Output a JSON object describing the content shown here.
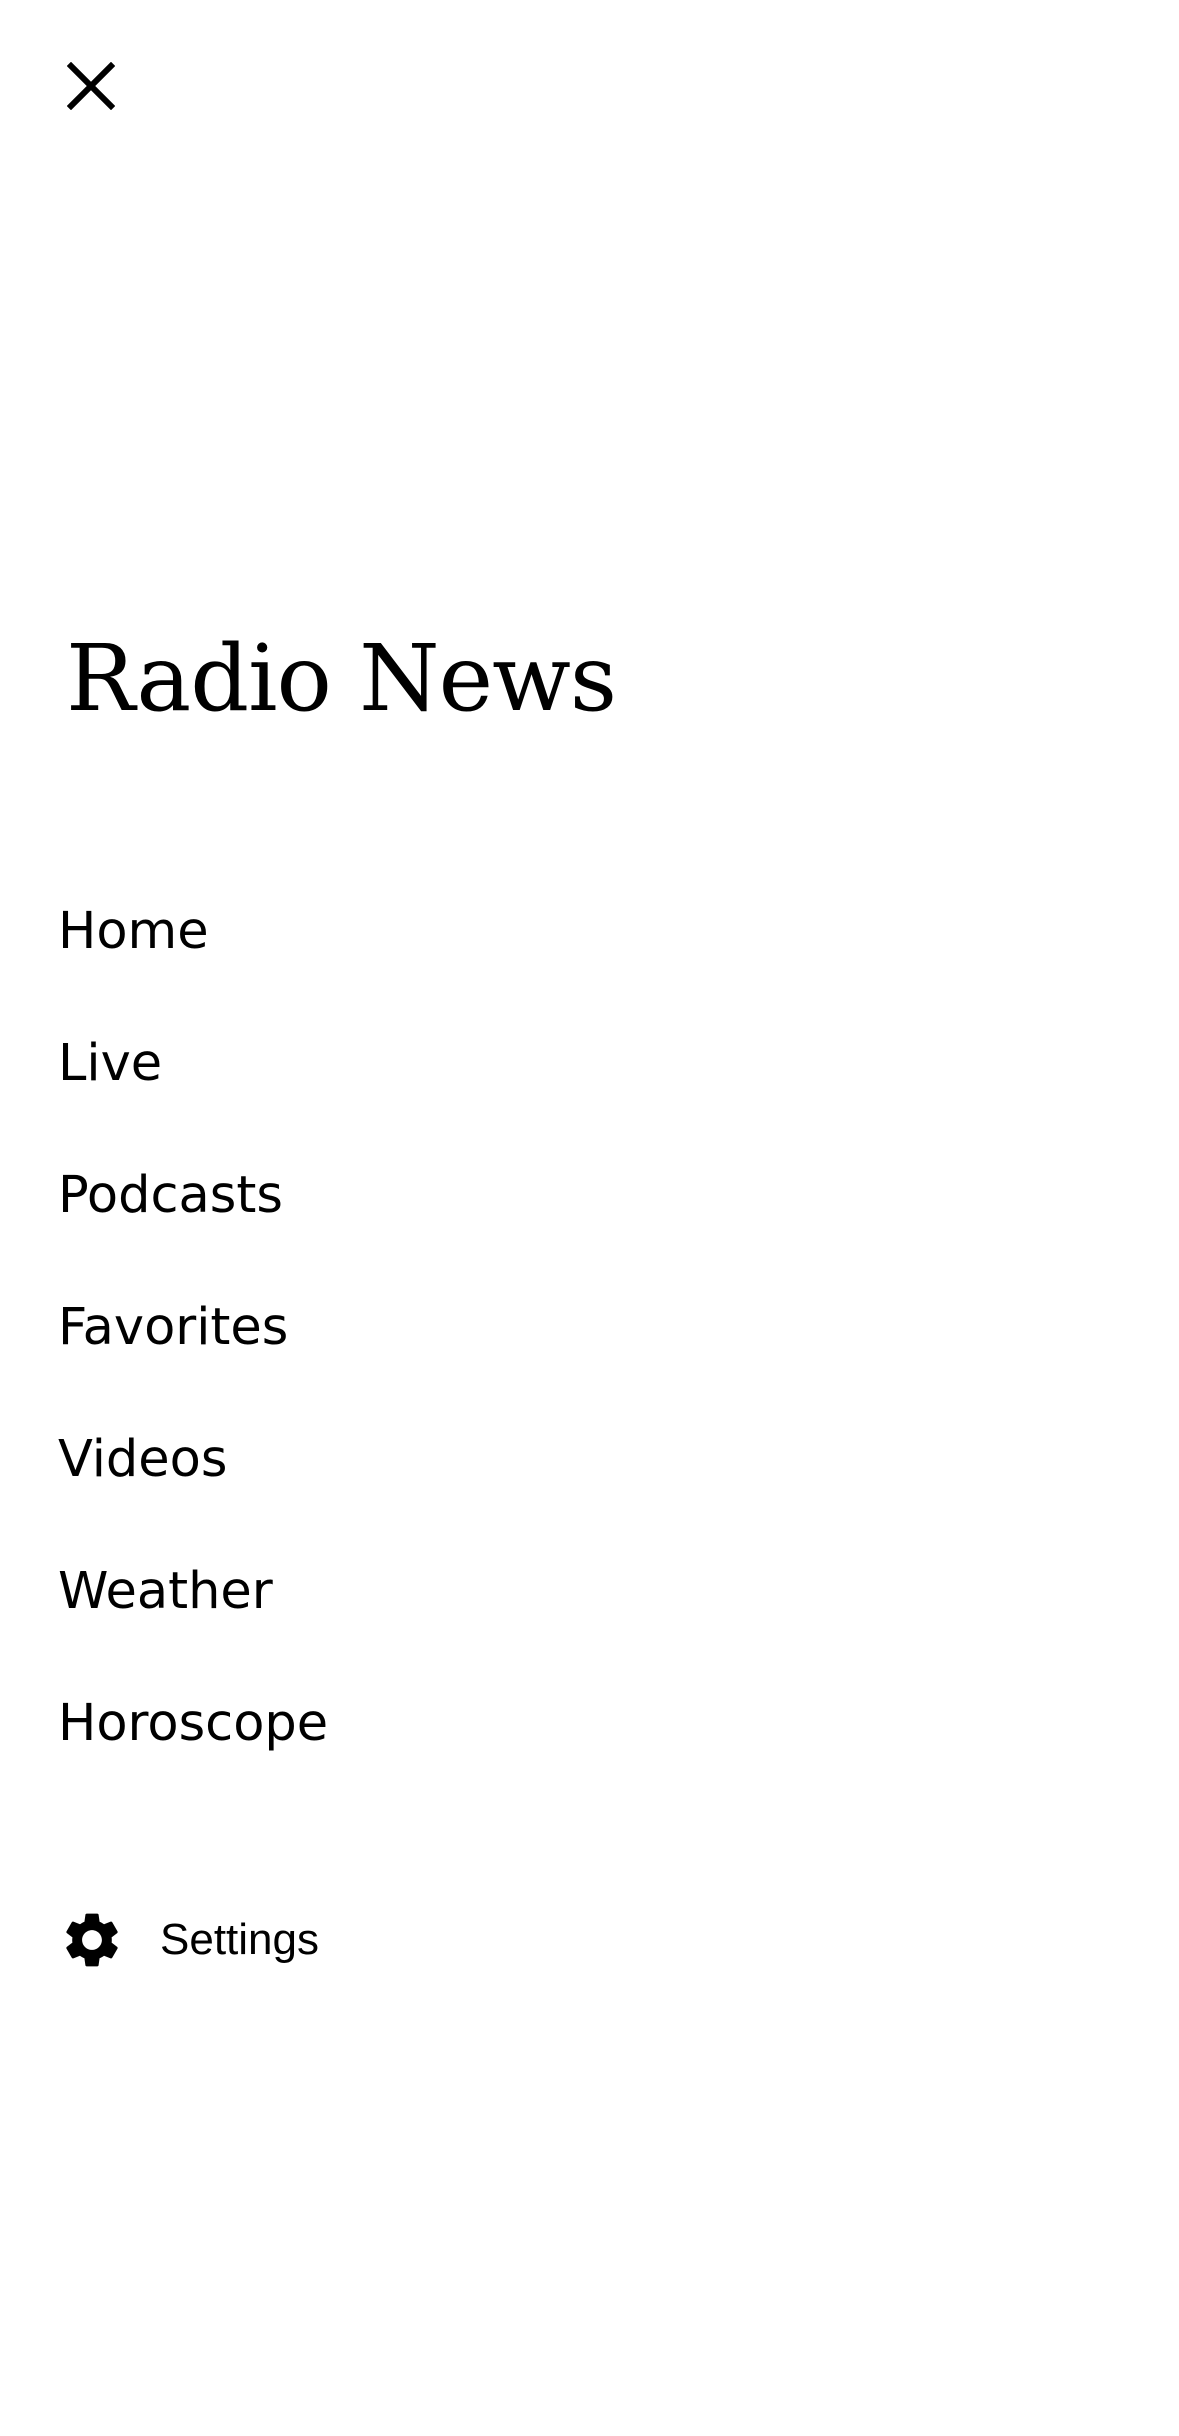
{
  "drawer": {
    "close_icon": "close-icon",
    "brand_title": "Radio News",
    "nav_items": [
      {
        "label": "Home"
      },
      {
        "label": "Live"
      },
      {
        "label": "Podcasts"
      },
      {
        "label": "Favorites"
      },
      {
        "label": "Videos"
      },
      {
        "label": "Weather"
      },
      {
        "label": "Horoscope"
      }
    ],
    "settings": {
      "label": "Settings",
      "icon": "gear-icon"
    }
  },
  "colors": {
    "background": "#ffffff",
    "text": "#000000"
  }
}
